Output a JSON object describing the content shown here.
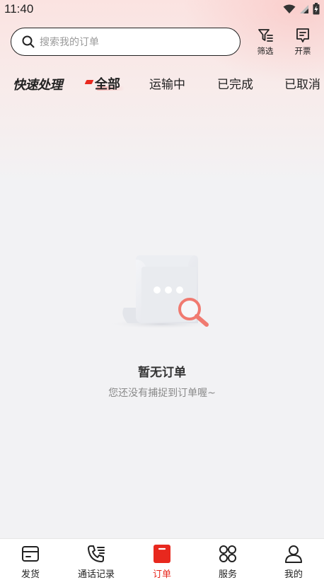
{
  "status_bar": {
    "time": "11:40"
  },
  "search": {
    "placeholder": "搜索我的订单"
  },
  "toolbar": {
    "filter_label": "筛选",
    "invoice_label": "开票"
  },
  "tabs": {
    "brand": "快速处理",
    "items": [
      {
        "label": "全部",
        "active": true
      },
      {
        "label": "运输中",
        "active": false
      },
      {
        "label": "已完成",
        "active": false
      },
      {
        "label": "已取消",
        "active": false
      }
    ]
  },
  "empty_state": {
    "title": "暂无订单",
    "subtitle": "您还没有捕捉到订单喔~"
  },
  "bottom_nav": {
    "items": [
      {
        "label": "发货",
        "icon": "box-icon",
        "active": false
      },
      {
        "label": "通话记录",
        "icon": "phone-icon",
        "active": false
      },
      {
        "label": "订单",
        "icon": "order-icon",
        "active": true
      },
      {
        "label": "服务",
        "icon": "grid-icon",
        "active": false
      },
      {
        "label": "我的",
        "icon": "user-icon",
        "active": false
      }
    ]
  },
  "colors": {
    "accent": "#e8281e",
    "background": "#f2f2f4"
  }
}
